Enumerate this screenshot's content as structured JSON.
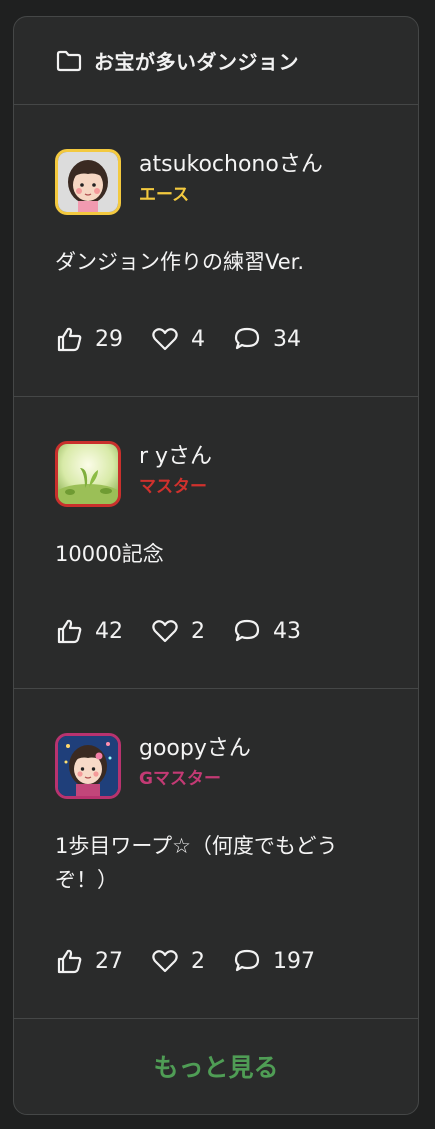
{
  "header": {
    "title": "お宝が多いダンジョン",
    "icon": "folder-icon"
  },
  "entries": [
    {
      "username": "atsukochonoさん",
      "rank": "エース",
      "rank_color": "#f3c93f",
      "avatar_border": "#f3c93f",
      "title": "ダンジョン作りの練習Ver.",
      "likes": "29",
      "favorites": "4",
      "comments": "34"
    },
    {
      "username": "r yさん",
      "rank": "マスター",
      "rank_color": "#d0312d",
      "avatar_border": "#c9302c",
      "title": "10000記念",
      "likes": "42",
      "favorites": "2",
      "comments": "43"
    },
    {
      "username": "goopyさん",
      "rank": "Gマスター",
      "rank_color": "#c33a74",
      "avatar_border": "#b8336f",
      "title": "1歩目ワープ☆（何度でもどうぞ！）",
      "likes": "27",
      "favorites": "2",
      "comments": "197"
    }
  ],
  "more_label": "もっと見る",
  "colors": {
    "background": "#1f2020",
    "card": "#2a2b2b",
    "border": "#454747",
    "more": "#4f9d55"
  }
}
